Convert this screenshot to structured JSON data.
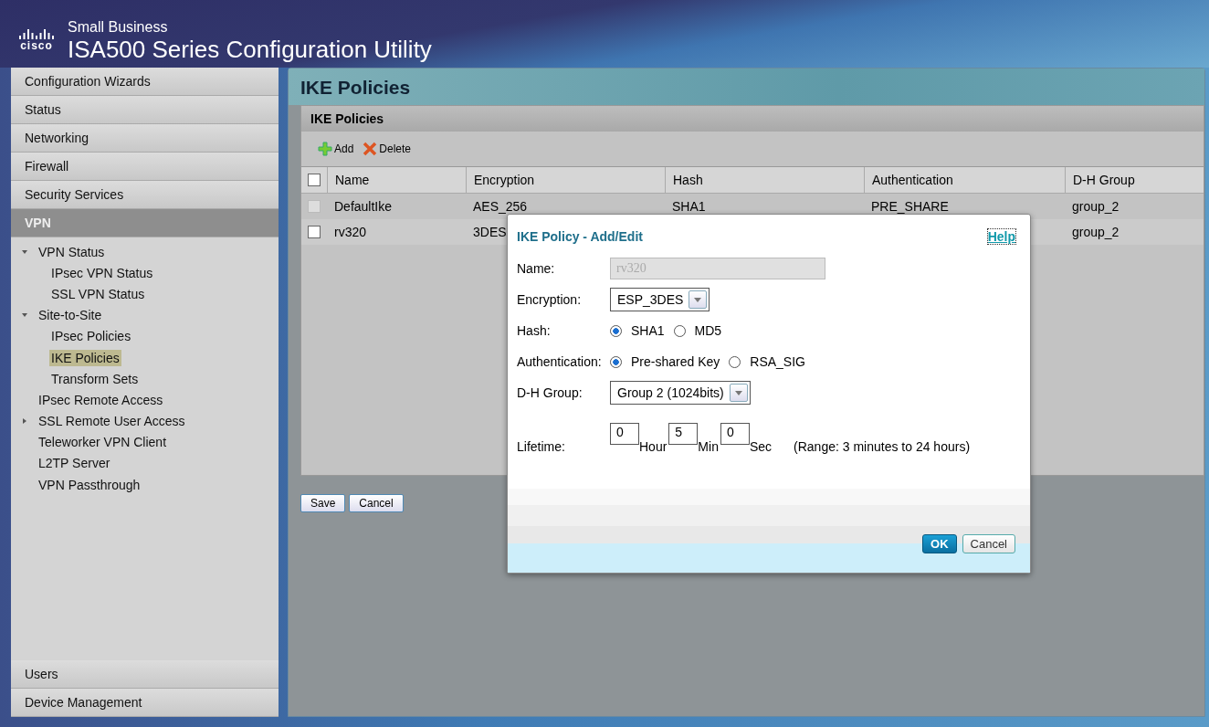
{
  "header": {
    "brand": "cisco",
    "subtitle": "Small Business",
    "title": "ISA500 Series Configuration Utility"
  },
  "sidebar": {
    "sections": [
      {
        "label": "Configuration Wizards",
        "selected": false
      },
      {
        "label": "Status",
        "selected": false
      },
      {
        "label": "Networking",
        "selected": false
      },
      {
        "label": "Firewall",
        "selected": false
      },
      {
        "label": "Security Services",
        "selected": false
      },
      {
        "label": "VPN",
        "selected": true
      }
    ],
    "tree": [
      {
        "label": "VPN Status",
        "expanded": true,
        "selected": false,
        "children": [
          {
            "label": "IPsec VPN Status",
            "selected": false
          },
          {
            "label": "SSL VPN Status",
            "selected": false
          }
        ]
      },
      {
        "label": "Site-to-Site",
        "expanded": true,
        "selected": false,
        "children": [
          {
            "label": "IPsec Policies",
            "selected": false
          },
          {
            "label": "IKE Policies",
            "selected": true
          },
          {
            "label": "Transform Sets",
            "selected": false
          }
        ]
      },
      {
        "label": "IPsec Remote Access",
        "selected": false
      },
      {
        "label": "SSL Remote User Access",
        "expanded": false,
        "selected": false
      },
      {
        "label": "Teleworker VPN Client",
        "selected": false
      },
      {
        "label": "L2TP Server",
        "selected": false
      },
      {
        "label": "VPN Passthrough",
        "selected": false
      }
    ],
    "bottom_sections": [
      {
        "label": "Users",
        "selected": false
      },
      {
        "label": "Device Management",
        "selected": false
      }
    ]
  },
  "page": {
    "title": "IKE Policies",
    "panel_title": "IKE Policies",
    "toolbar": [
      {
        "kind": "add",
        "label": "Add"
      },
      {
        "kind": "delete",
        "label": "Delete"
      }
    ],
    "table": {
      "select_all": {
        "checked": false
      },
      "columns": [
        "Name",
        "Encryption",
        "Hash",
        "Authentication",
        "D-H Group"
      ],
      "rows": [
        {
          "checked": false,
          "disabled": true,
          "cells": [
            "DefaultIke",
            "AES_256",
            "SHA1",
            "PRE_SHARE",
            "group_2"
          ]
        },
        {
          "checked": false,
          "disabled": false,
          "cells": [
            "rv320",
            "3DES",
            "",
            "",
            "group_2"
          ]
        }
      ]
    },
    "buttons": [
      "Save",
      "Cancel"
    ]
  },
  "dialog": {
    "title": "IKE Policy - Add/Edit",
    "help": "Help",
    "name": {
      "label": "Name:",
      "value": "rv320",
      "disabled": true
    },
    "encryption": {
      "label": "Encryption:",
      "value": "ESP_3DES"
    },
    "hash": {
      "label": "Hash:",
      "options": [
        {
          "label": "SHA1",
          "selected": true
        },
        {
          "label": "MD5",
          "selected": false
        }
      ]
    },
    "authentication": {
      "label": "Authentication:",
      "options": [
        {
          "label": "Pre-shared Key",
          "selected": true
        },
        {
          "label": "RSA_SIG",
          "selected": false
        }
      ]
    },
    "dh_group": {
      "label": "D-H Group:",
      "value": "Group 2 (1024bits)"
    },
    "lifetime": {
      "label": "Lifetime:",
      "parts": [
        {
          "value": "0",
          "unit": "Hour"
        },
        {
          "value": "5",
          "unit": "Min"
        },
        {
          "value": "0",
          "unit": "Sec"
        }
      ],
      "range": "(Range: 3 minutes to 24 hours)"
    },
    "buttons": [
      {
        "kind": "primary",
        "label": "OK"
      },
      {
        "kind": "secondary",
        "label": "Cancel"
      }
    ]
  }
}
